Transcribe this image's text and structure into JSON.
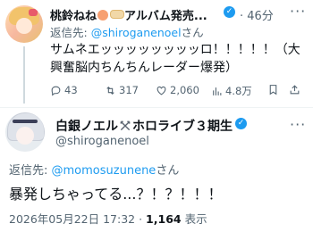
{
  "tweet1": {
    "name": "桃鈴ねね",
    "name_suffix": "アルバム発売...",
    "time": "· 46分",
    "reply_prefix": "返信先: ",
    "reply_handle": "@shiroganenoel",
    "reply_suffix": "さん",
    "body": "サムネエッッッッッッッッロ！！！！！（大興奮脳内ちんちんレーダー爆発）",
    "stats": {
      "replies": "43",
      "retweets": "317",
      "likes": "2,060",
      "views": "4.8万"
    }
  },
  "tweet2": {
    "name": "白銀ノエル",
    "name_suffix": "ホロライブ３期生",
    "handle": "@shiroganenoel",
    "reply_prefix": "返信先: ",
    "reply_handle": "@momosuzunene",
    "reply_suffix": "さん",
    "body": "暴発しちゃってる...？！？！！！",
    "timestamp": "2026年05月22日 17:32",
    "dot": " · ",
    "views_count": "1,164",
    "views_label": " 表示"
  },
  "icons": [
    "reply-icon",
    "retweet-icon",
    "like-icon",
    "views-icon",
    "bookmark-icon",
    "share-icon",
    "verified-icon",
    "more-icon",
    "crossed-swords-icon"
  ],
  "colors": {
    "verified": "#1d9bf0",
    "link": "#1d9bf0",
    "secondary_text": "#536471"
  }
}
